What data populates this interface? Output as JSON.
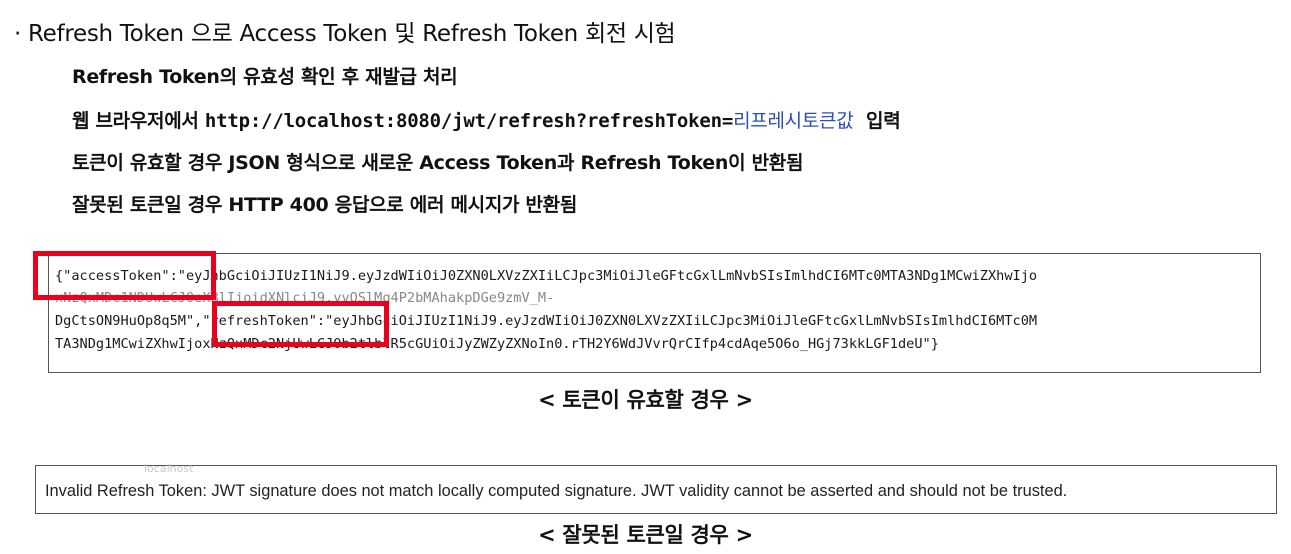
{
  "heading": "· Refresh Token 으로 Access Token 및 Refresh Token 회전 시험",
  "bullets": {
    "b1": "Refresh Token의 유효성 확인 후 재발급 처리",
    "b2_prefix": "웹 브라우저에서 ",
    "b2_url": "http://localhost:8080/jwt/refresh?refreshToken=",
    "b2_placeholder": "리프레시토큰값",
    "b2_suffix": "  입력",
    "b3": "토큰이 유효할 경우 JSON 형식으로 새로운 Access Token과 Refresh Token이 반환됨",
    "b4": "잘못된 토큰일 경우 HTTP 400 응답으로 에러 메시지가 반환됨"
  },
  "valid_response": {
    "line1": "{\"accessToken\":\"eyJhbGciOiJIUzI1NiJ9.eyJzdWIiOiJ0ZXN0LXVzZXIiLCJpc3MiOiJleGFtcGxlLmNvbSIsImlhdCI6MTc0MTA3NDg1MCwiZXhwIjo",
    "line2": "xNzQxMDc1NDUwLCJ0eXBlIjoidXNlciJ9.yvQSlMq4P2bMAhakpDGe9zmV_M-",
    "line3": "DgCtsON9HuOp8q5M\",\"refreshToken\":\"eyJhbGciOiJIUzI1NiJ9.eyJzdWIiOiJ0ZXN0LXVzZXIiLCJpc3MiOiJleGFtcGxlLmNvbSIsImlhdCI6MTc0M",
    "line4": "TA3NDg1MCwiZXhwIjoxNzQxMDc2NjUwLCJ0b2tlblR5cGUiOiJyZWZyZXNoIn0.rTH2Y6WdJVvrQrCIfp4cdAqe5O6o_HGj73kkLGF1deU\"}"
  },
  "caption_valid": "< 토큰이 유효할 경우 >",
  "invalid_response": {
    "ghost_text": "localhost",
    "message": "Invalid Refresh Token: JWT signature does not match locally computed signature. JWT validity cannot be asserted and should not be trusted."
  },
  "caption_invalid": "< 잘못된 토큰일 경우 >",
  "colors": {
    "highlight_box": "#e8001c",
    "placeholder_text": "#2b4fb8"
  }
}
